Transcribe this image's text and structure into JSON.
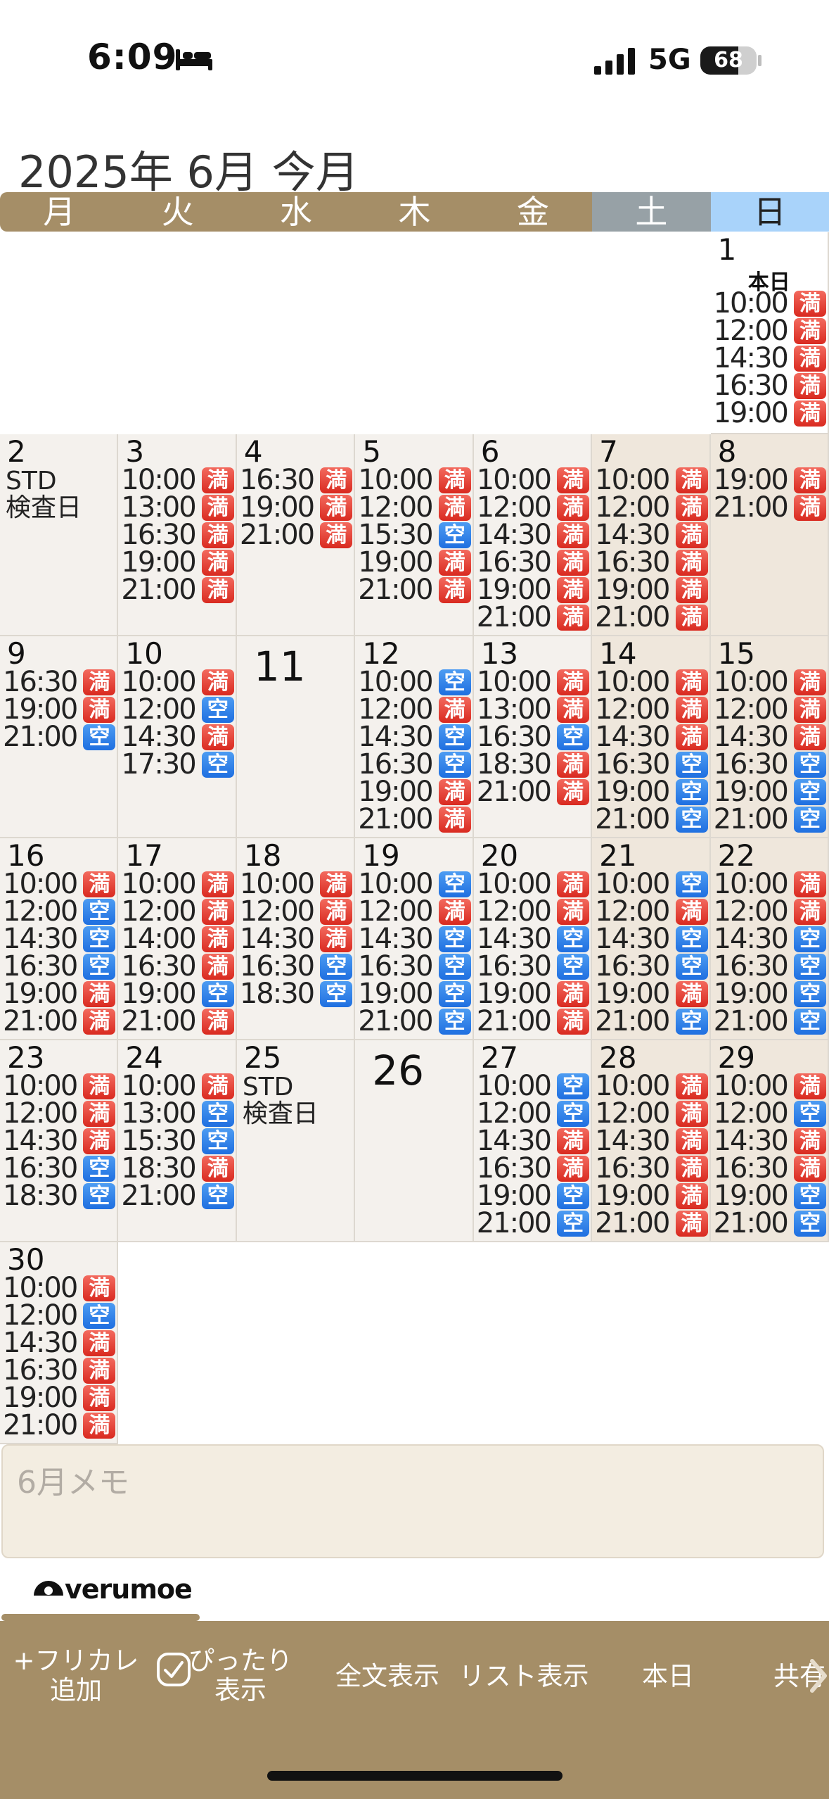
{
  "status": {
    "time": "6:09",
    "network": "5G",
    "battery": "68",
    "battery_level_percent": 68
  },
  "header": {
    "title": "2025年 6月 今月"
  },
  "weekdays": [
    "月",
    "火",
    "水",
    "木",
    "金",
    "土",
    "日"
  ],
  "legend": {
    "full": "満",
    "open": "空"
  },
  "calendar": {
    "leading_blank_days": 6,
    "days": [
      {
        "day": "1",
        "today": true,
        "today_label": "本日",
        "slots": [
          [
            "10:00",
            "full"
          ],
          [
            "12:00",
            "full"
          ],
          [
            "14:30",
            "full"
          ],
          [
            "16:30",
            "full"
          ],
          [
            "19:00",
            "full"
          ]
        ]
      },
      {
        "day": "2",
        "notes": [
          "STD",
          "検査日"
        ],
        "slots": []
      },
      {
        "day": "3",
        "slots": [
          [
            "10:00",
            "full"
          ],
          [
            "13:00",
            "full"
          ],
          [
            "16:30",
            "full"
          ],
          [
            "19:00",
            "full"
          ],
          [
            "21:00",
            "full"
          ]
        ]
      },
      {
        "day": "4",
        "slots": [
          [
            "16:30",
            "full"
          ],
          [
            "19:00",
            "full"
          ],
          [
            "21:00",
            "full"
          ]
        ]
      },
      {
        "day": "5",
        "slots": [
          [
            "10:00",
            "full"
          ],
          [
            "12:00",
            "full"
          ],
          [
            "15:30",
            "open"
          ],
          [
            "19:00",
            "full"
          ],
          [
            "21:00",
            "full"
          ]
        ]
      },
      {
        "day": "6",
        "slots": [
          [
            "10:00",
            "full"
          ],
          [
            "12:00",
            "full"
          ],
          [
            "14:30",
            "full"
          ],
          [
            "16:30",
            "full"
          ],
          [
            "19:00",
            "full"
          ],
          [
            "21:00",
            "full"
          ]
        ]
      },
      {
        "day": "7",
        "slots": [
          [
            "10:00",
            "full"
          ],
          [
            "12:00",
            "full"
          ],
          [
            "14:30",
            "full"
          ],
          [
            "16:30",
            "full"
          ],
          [
            "19:00",
            "full"
          ],
          [
            "21:00",
            "full"
          ]
        ]
      },
      {
        "day": "8",
        "slots": [
          [
            "19:00",
            "full"
          ],
          [
            "21:00",
            "full"
          ]
        ]
      },
      {
        "day": "9",
        "slots": [
          [
            "16:30",
            "full"
          ],
          [
            "19:00",
            "full"
          ],
          [
            "21:00",
            "open"
          ]
        ]
      },
      {
        "day": "10",
        "slots": [
          [
            "10:00",
            "full"
          ],
          [
            "12:00",
            "open"
          ],
          [
            "14:30",
            "full"
          ],
          [
            "17:30",
            "open"
          ]
        ]
      },
      {
        "day": "11",
        "big": true,
        "slots": []
      },
      {
        "day": "12",
        "slots": [
          [
            "10:00",
            "open"
          ],
          [
            "12:00",
            "full"
          ],
          [
            "14:30",
            "open"
          ],
          [
            "16:30",
            "open"
          ],
          [
            "19:00",
            "full"
          ],
          [
            "21:00",
            "full"
          ]
        ]
      },
      {
        "day": "13",
        "slots": [
          [
            "10:00",
            "full"
          ],
          [
            "13:00",
            "full"
          ],
          [
            "16:30",
            "open"
          ],
          [
            "18:30",
            "full"
          ],
          [
            "21:00",
            "full"
          ]
        ]
      },
      {
        "day": "14",
        "slots": [
          [
            "10:00",
            "full"
          ],
          [
            "12:00",
            "full"
          ],
          [
            "14:30",
            "full"
          ],
          [
            "16:30",
            "open"
          ],
          [
            "19:00",
            "open"
          ],
          [
            "21:00",
            "open"
          ]
        ]
      },
      {
        "day": "15",
        "slots": [
          [
            "10:00",
            "full"
          ],
          [
            "12:00",
            "full"
          ],
          [
            "14:30",
            "full"
          ],
          [
            "16:30",
            "open"
          ],
          [
            "19:00",
            "open"
          ],
          [
            "21:00",
            "open"
          ]
        ]
      },
      {
        "day": "16",
        "slots": [
          [
            "10:00",
            "full"
          ],
          [
            "12:00",
            "open"
          ],
          [
            "14:30",
            "open"
          ],
          [
            "16:30",
            "open"
          ],
          [
            "19:00",
            "full"
          ],
          [
            "21:00",
            "full"
          ]
        ]
      },
      {
        "day": "17",
        "slots": [
          [
            "10:00",
            "full"
          ],
          [
            "12:00",
            "full"
          ],
          [
            "14:00",
            "full"
          ],
          [
            "16:30",
            "full"
          ],
          [
            "19:00",
            "open"
          ],
          [
            "21:00",
            "full"
          ]
        ]
      },
      {
        "day": "18",
        "slots": [
          [
            "10:00",
            "full"
          ],
          [
            "12:00",
            "full"
          ],
          [
            "14:30",
            "full"
          ],
          [
            "16:30",
            "open"
          ],
          [
            "18:30",
            "open"
          ]
        ]
      },
      {
        "day": "19",
        "slots": [
          [
            "10:00",
            "open"
          ],
          [
            "12:00",
            "full"
          ],
          [
            "14:30",
            "open"
          ],
          [
            "16:30",
            "open"
          ],
          [
            "19:00",
            "open"
          ],
          [
            "21:00",
            "open"
          ]
        ]
      },
      {
        "day": "20",
        "slots": [
          [
            "10:00",
            "full"
          ],
          [
            "12:00",
            "full"
          ],
          [
            "14:30",
            "open"
          ],
          [
            "16:30",
            "open"
          ],
          [
            "19:00",
            "full"
          ],
          [
            "21:00",
            "full"
          ]
        ]
      },
      {
        "day": "21",
        "slots": [
          [
            "10:00",
            "open"
          ],
          [
            "12:00",
            "full"
          ],
          [
            "14:30",
            "open"
          ],
          [
            "16:30",
            "open"
          ],
          [
            "19:00",
            "full"
          ],
          [
            "21:00",
            "open"
          ]
        ]
      },
      {
        "day": "22",
        "slots": [
          [
            "10:00",
            "full"
          ],
          [
            "12:00",
            "full"
          ],
          [
            "14:30",
            "open"
          ],
          [
            "16:30",
            "open"
          ],
          [
            "19:00",
            "open"
          ],
          [
            "21:00",
            "open"
          ]
        ]
      },
      {
        "day": "23",
        "slots": [
          [
            "10:00",
            "full"
          ],
          [
            "12:00",
            "full"
          ],
          [
            "14:30",
            "full"
          ],
          [
            "16:30",
            "open"
          ],
          [
            "18:30",
            "open"
          ]
        ]
      },
      {
        "day": "24",
        "slots": [
          [
            "10:00",
            "full"
          ],
          [
            "13:00",
            "open"
          ],
          [
            "15:30",
            "open"
          ],
          [
            "18:30",
            "full"
          ],
          [
            "21:00",
            "open"
          ]
        ]
      },
      {
        "day": "25",
        "notes": [
          "STD",
          "検査日"
        ],
        "slots": []
      },
      {
        "day": "26",
        "big": true,
        "slots": []
      },
      {
        "day": "27",
        "slots": [
          [
            "10:00",
            "open"
          ],
          [
            "12:00",
            "open"
          ],
          [
            "14:30",
            "full"
          ],
          [
            "16:30",
            "full"
          ],
          [
            "19:00",
            "open"
          ],
          [
            "21:00",
            "open"
          ]
        ]
      },
      {
        "day": "28",
        "slots": [
          [
            "10:00",
            "full"
          ],
          [
            "12:00",
            "full"
          ],
          [
            "14:30",
            "full"
          ],
          [
            "16:30",
            "full"
          ],
          [
            "19:00",
            "full"
          ],
          [
            "21:00",
            "full"
          ]
        ]
      },
      {
        "day": "29",
        "slots": [
          [
            "10:00",
            "full"
          ],
          [
            "12:00",
            "open"
          ],
          [
            "14:30",
            "full"
          ],
          [
            "16:30",
            "full"
          ],
          [
            "19:00",
            "open"
          ],
          [
            "21:00",
            "open"
          ]
        ]
      },
      {
        "day": "30",
        "slots": [
          [
            "10:00",
            "full"
          ],
          [
            "12:00",
            "open"
          ],
          [
            "14:30",
            "full"
          ],
          [
            "16:30",
            "full"
          ],
          [
            "19:00",
            "full"
          ],
          [
            "21:00",
            "full"
          ]
        ]
      }
    ]
  },
  "memo": {
    "placeholder": "6月メモ"
  },
  "logo": {
    "text": "verumoe"
  },
  "toolbar": {
    "add_free_calendar": "+フリカレ\n追加",
    "fit_display": "ぴったり\n表示",
    "full_text": "全文表示",
    "list_view": "リスト表示",
    "today": "本日",
    "share": "共有"
  },
  "colors": {
    "brand": "#a58e67",
    "full": "#e03a2f",
    "open": "#2a7be6",
    "sunday_header": "#a9d3fa",
    "saturday_header": "#97a1a6"
  }
}
